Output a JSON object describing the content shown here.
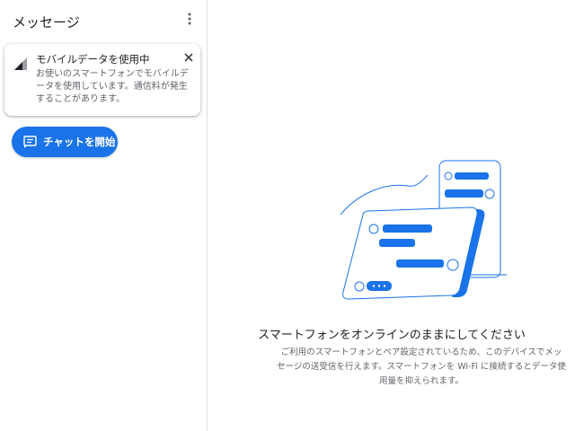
{
  "sidebar": {
    "title": "メッセージ",
    "menu_icon": "more-vert-icon",
    "notice": {
      "icon": "signal-icon",
      "title": "モバイルデータを使用中",
      "body": "お使いのスマートフォンでモバイルデータを使用しています。通信料が発生することがあります。",
      "close_icon": "close-icon"
    },
    "start_chat": {
      "icon": "chat-icon",
      "label": "チャットを開始"
    }
  },
  "main": {
    "illustration": "phone-and-chat-illustration",
    "title": "スマートフォンをオンラインのままにしてください",
    "description": "ご利用のスマートフォンとペア設定されているため、このデバイスでメッセージの送受信を行えます。スマートフォンを Wi-Fi に接続するとデータ使用量を抑えられます。"
  },
  "colors": {
    "accent": "#1a73e8",
    "text_primary": "#202124",
    "text_secondary": "#5f6368",
    "divider": "#e0e0e0"
  }
}
